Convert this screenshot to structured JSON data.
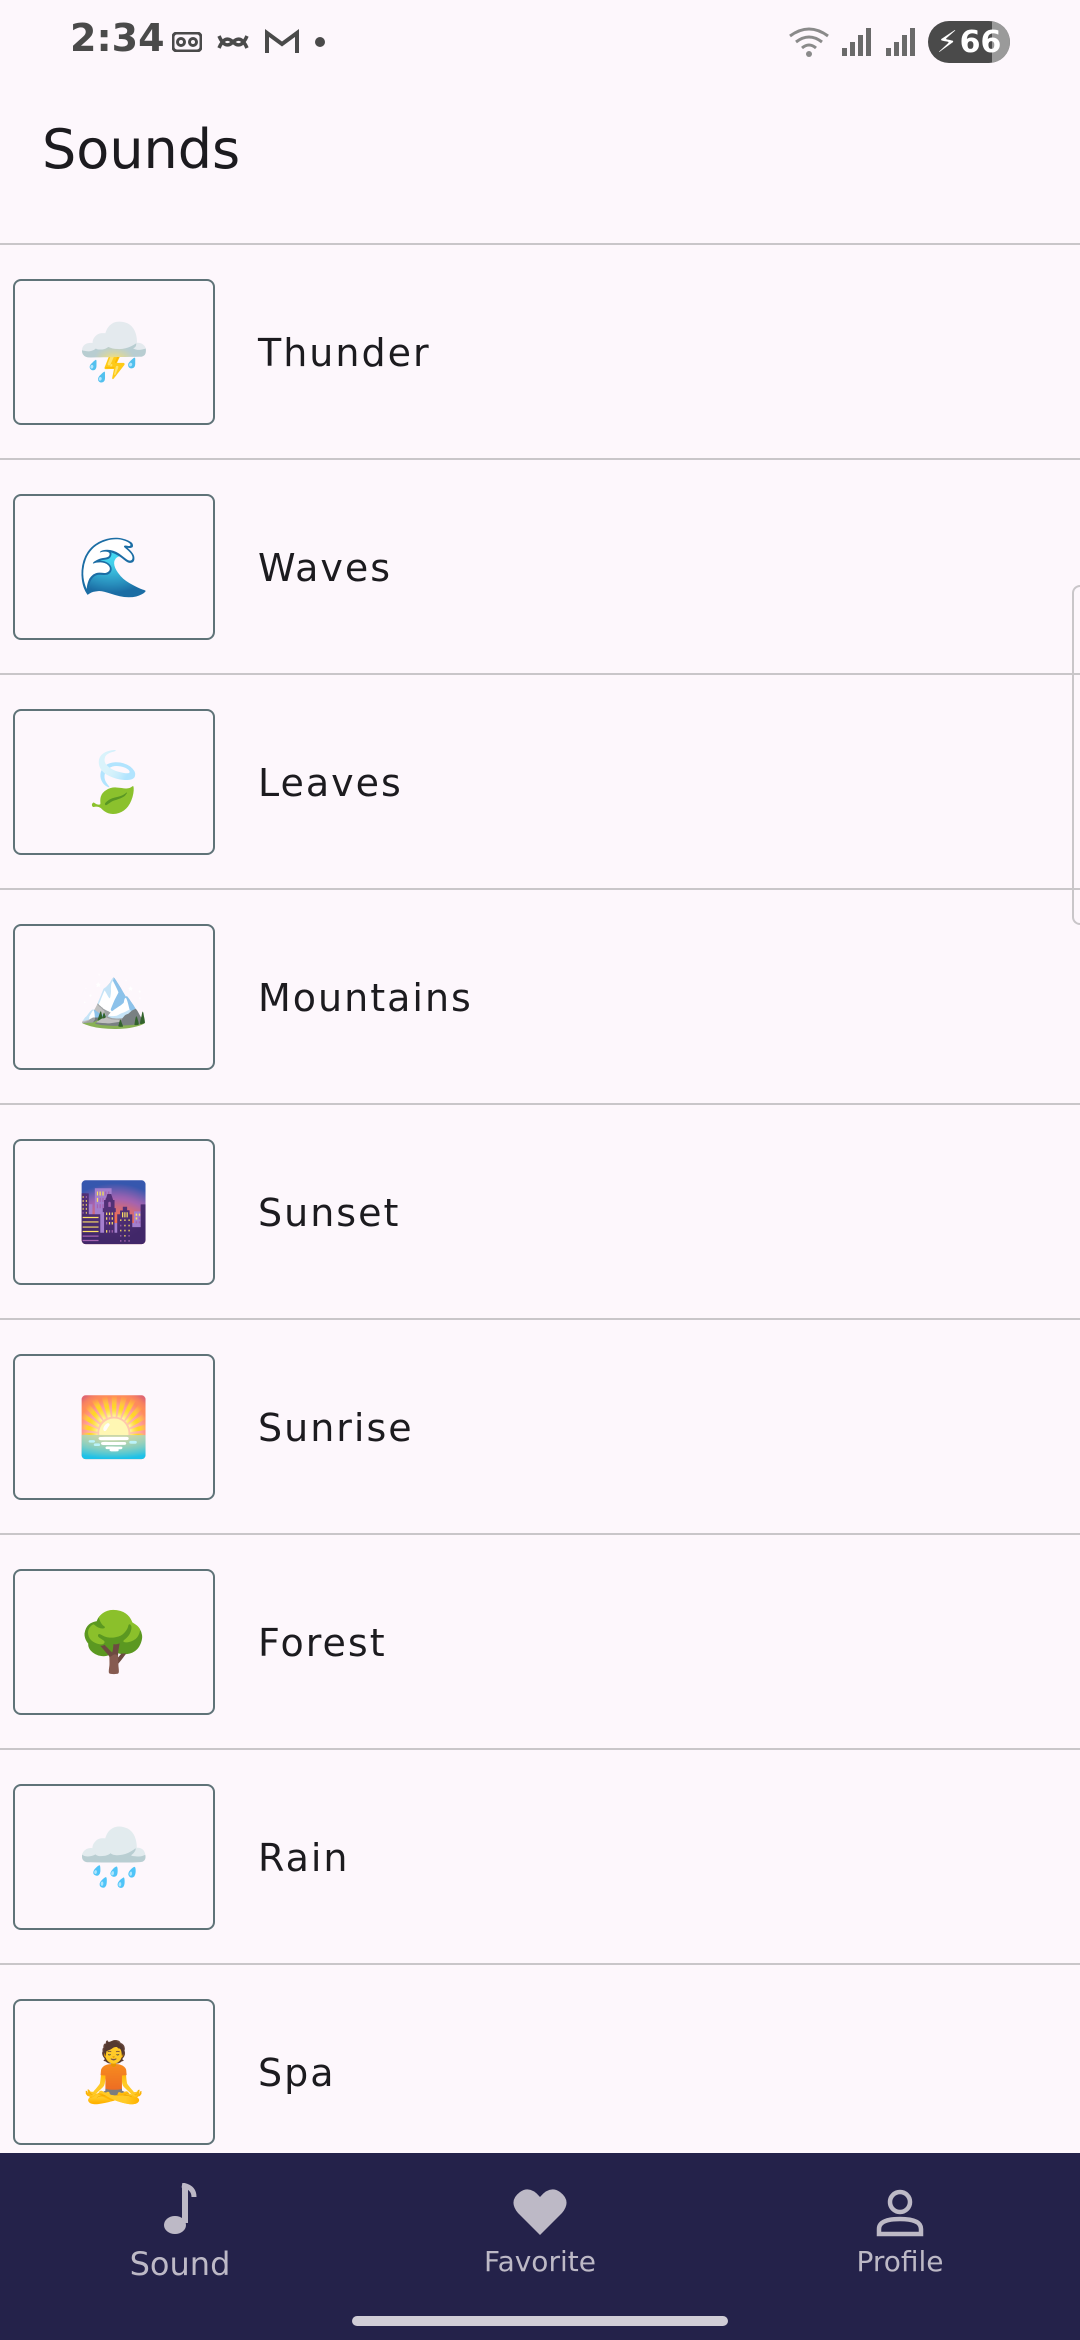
{
  "status_bar": {
    "time": "2:34",
    "battery_level": "66",
    "icons": [
      "voicemail-icon",
      "link-icon",
      "gmail-icon",
      "dot-icon",
      "wifi-icon",
      "signal-icon",
      "signal-icon",
      "battery-charging-icon"
    ]
  },
  "header": {
    "title": "Sounds"
  },
  "sounds": {
    "items": [
      {
        "label": "Thunder",
        "emoji": "⛈️",
        "icon": "thunder-icon"
      },
      {
        "label": "Waves",
        "emoji": "🌊",
        "icon": "wave-icon"
      },
      {
        "label": "Leaves",
        "emoji": "🍃",
        "icon": "leaf-icon"
      },
      {
        "label": "Mountains",
        "emoji": "🏔️",
        "icon": "mountain-icon"
      },
      {
        "label": "Sunset",
        "emoji": "🌆",
        "icon": "sunset-icon"
      },
      {
        "label": "Sunrise",
        "emoji": "🌅",
        "icon": "sunrise-icon"
      },
      {
        "label": "Forest",
        "emoji": "🌳",
        "icon": "tree-icon"
      },
      {
        "label": "Rain",
        "emoji": "🌧️",
        "icon": "rain-icon"
      },
      {
        "label": "Spa",
        "emoji": "🧘",
        "icon": "meditation-icon"
      }
    ]
  },
  "bottom_nav": {
    "sound_label": "Sound",
    "favorite_label": "Favorite",
    "profile_label": "Profile"
  },
  "colors": {
    "background": "#FDF7FC",
    "nav_background": "#24224a",
    "divider": "#c9c6c9",
    "thumb_border": "#5f7378",
    "nav_text": "#bdb9c6"
  }
}
